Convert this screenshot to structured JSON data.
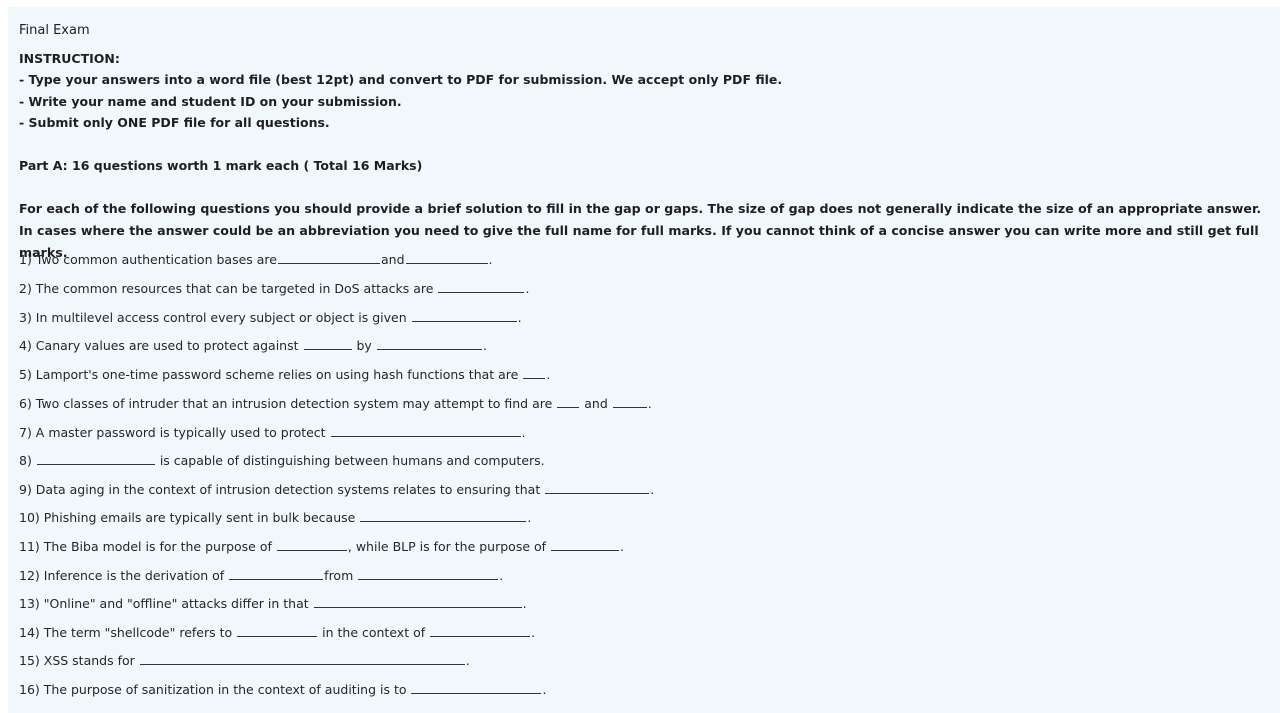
{
  "header": {
    "title": "Final Exam"
  },
  "instructions": {
    "heading": "INSTRUCTION:",
    "items": [
      "- Type your answers into a word file (best 12pt) and convert to PDF for submission. We accept only PDF file.",
      "- Write your name and student ID on your submission.",
      "- Submit only ONE PDF file for all questions."
    ]
  },
  "part_a": {
    "heading": "Part A:  16 questions worth 1 mark each ( Total 16 Marks)",
    "intro": "For each  of the following questions you should provide a brief solution to fill in the gap or gaps. The size of gap does not generally indicate the size of an appropriate answer. In cases where the answer could be an abbreviation you need to give the full name for full marks. If you cannot think of a concise answer you can write more and still get full marks."
  },
  "questions": [
    {
      "t1": "1) Two common authentication bases are",
      "t2": "and",
      "t3": "."
    },
    {
      "t1": "2) The common resources that can be targeted in DoS attacks are",
      "t2": "."
    },
    {
      "t1": "3) In multilevel access control every subject or object is given",
      "t2": "."
    },
    {
      "t1": "4) Canary values are used to protect against",
      "t2": "by",
      "t3": "."
    },
    {
      "t1": "5) Lamport's one-time password scheme relies on using hash functions that are",
      "t2": "."
    },
    {
      "t1": "6) Two classes of intruder that an intrusion detection system may attempt to find are",
      "t2": "and",
      "t3": "."
    },
    {
      "t1": "7) A master password is typically used to protect",
      "t2": "."
    },
    {
      "t1": "8)",
      "t2": "is capable of distinguishing between humans and computers."
    },
    {
      "t1": "9) Data aging in the context of intrusion detection systems relates to ensuring that",
      "t2": "."
    },
    {
      "t1": "10) Phishing emails are typically sent in bulk because",
      "t2": "."
    },
    {
      "t1": "11) The Biba model is for the purpose of",
      "t2": ", while BLP is for the purpose of",
      "t3": "."
    },
    {
      "t1": "12) Inference is the derivation of",
      "t2": "from",
      "t3": "."
    },
    {
      "t1": "13) \"Online\" and \"offline\" attacks differ in that",
      "t2": "."
    },
    {
      "t1": "14) The term \"shellcode\" refers to",
      "t2": "in the context of",
      "t3": "."
    },
    {
      "t1": "15) XSS stands for",
      "t2": "."
    },
    {
      "t1": "16) The purpose of sanitization in the context of auditing is to",
      "t2": "."
    }
  ]
}
